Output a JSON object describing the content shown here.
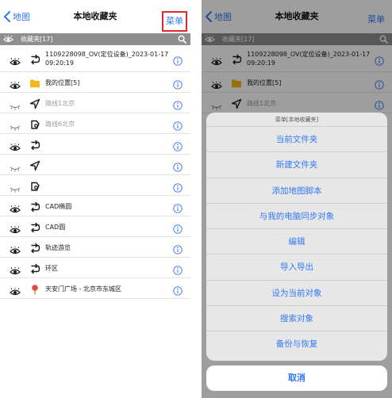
{
  "left": {
    "nav": {
      "back_label": "地图",
      "title": "本地收藏夹",
      "menu_label": "菜单"
    },
    "bar": {
      "label": "收藏夹[17]"
    },
    "rows": [
      {
        "visibility": "visible",
        "type": "route",
        "text": "1109228098_OV(定位设备)_2023-01-17 09:20:19",
        "dim": false
      },
      {
        "visibility": "visible",
        "type": "folder",
        "text": "我的位置[5]",
        "dim": false
      },
      {
        "visibility": "hidden",
        "type": "navigation",
        "text": "路线1北京",
        "dim": true
      },
      {
        "visibility": "hidden",
        "type": "polygon",
        "text": "路线6北京",
        "dim": true
      },
      {
        "visibility": "visible",
        "type": "route",
        "text": "",
        "dim": false
      },
      {
        "visibility": "hidden",
        "type": "navigation",
        "text": "",
        "dim": true
      },
      {
        "visibility": "hidden",
        "type": "polygon",
        "text": "",
        "dim": true
      },
      {
        "visibility": "visible",
        "type": "route",
        "text": "CAD椭圆",
        "dim": false
      },
      {
        "visibility": "visible",
        "type": "route",
        "text": "CAD圆",
        "dim": false
      },
      {
        "visibility": "visible",
        "type": "route",
        "text": "轨迹游览",
        "dim": false
      },
      {
        "visibility": "visible",
        "type": "route",
        "text": "环区",
        "dim": false
      },
      {
        "visibility": "visible",
        "type": "pin",
        "text": "天安门广场 - 北京市东城区",
        "dim": false
      }
    ]
  },
  "right": {
    "nav": {
      "back_label": "地图",
      "title": "本地收藏夹",
      "menu_label": "菜单"
    },
    "bar": {
      "label": "收藏夹[17]"
    },
    "rows": [
      {
        "visibility": "visible",
        "type": "route",
        "text": "1109228098_OV(定位设备)_2023-01-17 09:20:19",
        "dim": false
      },
      {
        "visibility": "visible",
        "type": "folder",
        "text": "我的位置[5]",
        "dim": false
      },
      {
        "visibility": "hidden",
        "type": "navigation",
        "text": "路线1北京",
        "dim": true
      }
    ],
    "sheet": {
      "title": "菜单[本地收藏夹]",
      "options": [
        "当前文件夹",
        "新建文件夹",
        "添加地图脚本",
        "与我的电脑同步对象",
        "编辑",
        "导入导出",
        "设为当前对象",
        "搜索对象",
        "备份与恢复"
      ],
      "cancel": "取消"
    }
  },
  "colors": {
    "accent": "#3478f6",
    "highlight_border": "#e0282e",
    "bar_bg": "#8e8e8e",
    "folder": "#f2b618",
    "pin": "#e34b3a"
  }
}
